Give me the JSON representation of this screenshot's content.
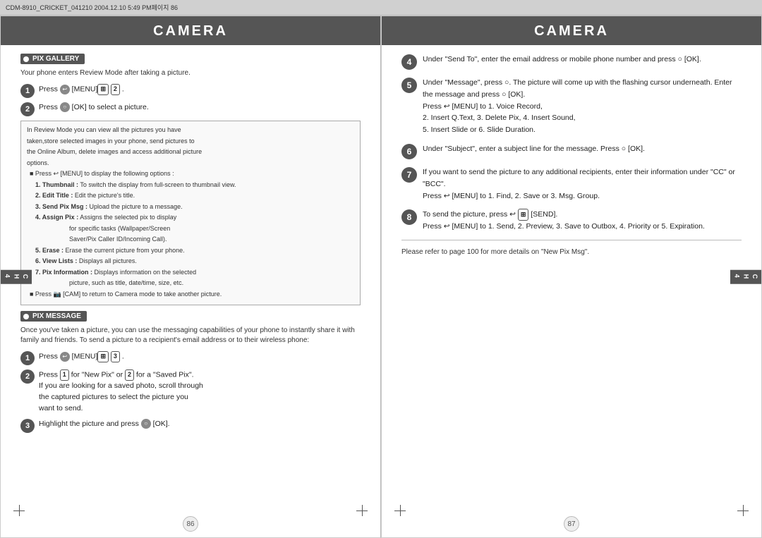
{
  "topbar": {
    "text": "CDM-8910_CRICKET_041210  2004.12.10 5:49 PM페이지 86"
  },
  "left_page": {
    "title": "CAMERA",
    "section1": {
      "heading": "PIX GALLERY",
      "intro": "Your phone enters Review Mode after taking a picture.",
      "steps": [
        {
          "number": "1",
          "text": "Press  [MENU]   ."
        },
        {
          "number": "2",
          "text": "Press  [OK] to select a picture."
        }
      ],
      "infobox": {
        "line1": "In Review Mode you can view all the pictures you have",
        "line2": "taken,store selected images in your phone, send pictures to",
        "line3": "the Online Album, delete images and access additional picture",
        "line4": "options.",
        "bullet1": "Press  [MENU] to display the following options :",
        "item1": "1. Thumbnail : To switch the display from full-screen to thumbnail view.",
        "item2": "2. Edit Title : Edit the picture's title.",
        "item3": "3. Send Pix Msg : Upload the picture to a message.",
        "item4": "4. Assign Pix : Assigns the selected pix to display",
        "item4b": "for specific tasks (Wallpaper/Screen",
        "item4c": "Saver/Pix Caller ID/Incoming Call).",
        "item5": "5. Erase : Erase the current picture from your phone.",
        "item6": "6. View Lists : Displays all pictures.",
        "item7": "7. Pix Information : Displays information on the selected",
        "item7b": "picture, such as title, date/time, size, etc.",
        "bullet2": "Press  [CAM] to return to Camera mode to take another picture."
      }
    },
    "section2": {
      "heading": "PIX MESSAGE",
      "intro": "Once you've taken a picture, you can use the messaging capabilities of your phone to instantly share it with family and friends. To send a picture to a recipient's email address or to their wireless phone:",
      "steps": [
        {
          "number": "1",
          "text": "Press  [MENU]   ."
        },
        {
          "number": "2",
          "text": "Press  for \"New Pix\" or   for a \"Saved Pix\".\nIf you are looking for a saved photo, scroll through the captured pictures to select the picture you want to send."
        },
        {
          "number": "3",
          "text": "Highlight the picture and press  [OK]."
        }
      ]
    },
    "side_tab": "C\nH\n4",
    "page_number": "86"
  },
  "right_page": {
    "title": "CAMERA",
    "steps": [
      {
        "number": "4",
        "text": "Under \"Send To\", enter the email address or mobile phone number and press  [OK]."
      },
      {
        "number": "5",
        "text": "Under \"Message\", press  .  The picture will come up with the flashing cursor underneath. Enter the message and press  [OK].\nPress  [MENU] to 1. Voice Record,\n2. Insert Q.Text, 3. Delete Pix, 4. Insert Sound,\n5. Insert Slide or 6. Slide Duration."
      },
      {
        "number": "6",
        "text": "Under \"Subject\", enter a subject line for the message. Press  [OK]."
      },
      {
        "number": "7",
        "text": "If you want to send the picture to any additional recipients, enter their information under \"CC\" or \"BCC\".\nPress  [MENU] to 1. Find, 2. Save or 3. Msg. Group."
      },
      {
        "number": "8",
        "text": "To send the picture, press   [SEND].\nPress  [MENU] to 1. Send, 2. Preview, 3. Save to Outbox, 4. Priority or 5. Expiration."
      }
    ],
    "footer_text": "Please refer to page 100 for more details on \"New Pix Msg\".",
    "side_tab": "C\nH\n4",
    "page_number": "87"
  }
}
